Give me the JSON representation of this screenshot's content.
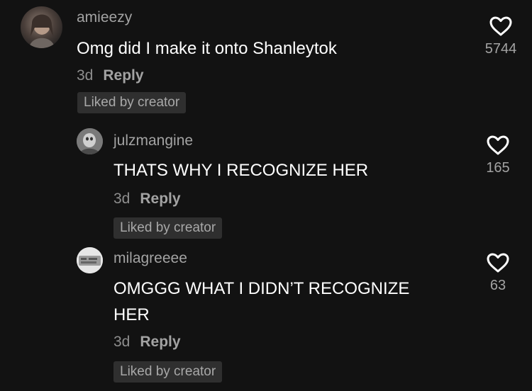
{
  "comments": [
    {
      "username": "amieezy",
      "text": "Omg did I make it onto Shanleytok",
      "age": "3d",
      "reply_label": "Reply",
      "badge": "Liked by creator",
      "likes": "5744"
    },
    {
      "username": "julzmangine",
      "text": "THATS WHY I RECOGNIZE HER",
      "age": "3d",
      "reply_label": "Reply",
      "badge": "Liked by creator",
      "likes": "165"
    },
    {
      "username": "milagreeee",
      "text": "OMGGG WHAT I DIDN’T RECOGNIZE HER",
      "age": "3d",
      "reply_label": "Reply",
      "badge": "Liked by creator",
      "likes": "63"
    }
  ],
  "colors": {
    "background": "#121212",
    "username": "#a3a3a3",
    "badge_bg": "#2f2f2f"
  },
  "icons": [
    "heart-outline-icon",
    "avatar"
  ]
}
